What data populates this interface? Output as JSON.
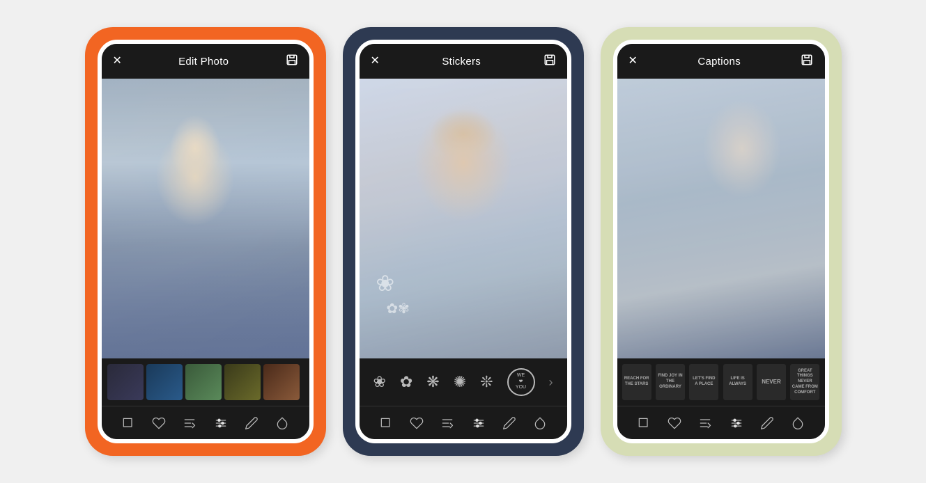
{
  "phones": [
    {
      "id": "edit-photo",
      "wrapperClass": "orange",
      "header": {
        "title": "Edit Photo",
        "closeIcon": "✕",
        "saveIcon": "💾"
      },
      "photoClass": "photo-winter",
      "stripType": "thumbnails",
      "thumbnails": [
        "thumb-1",
        "thumb-2",
        "thumb-3",
        "thumb-4",
        "thumb-5"
      ]
    },
    {
      "id": "stickers",
      "wrapperClass": "navy",
      "header": {
        "title": "Stickers",
        "closeIcon": "✕",
        "saveIcon": "💾"
      },
      "photoClass": "photo-sunglasses",
      "stripType": "stickers",
      "stickers": [
        "❀",
        "✿",
        "❋",
        "✺",
        "✻",
        "✾",
        "WE\n❤\nYOU"
      ]
    },
    {
      "id": "captions",
      "wrapperClass": "sage",
      "header": {
        "title": "Captions",
        "closeIcon": "✕",
        "saveIcon": "💾"
      },
      "photoClass": "photo-double",
      "stripType": "captions",
      "captions": [
        "reach for the stars",
        "find joy in the ordinary",
        "let's find a place",
        "life is always",
        "NEVER give up",
        "Great things never came from comfort zones"
      ]
    }
  ],
  "toolbar": {
    "icons": [
      "crop",
      "heart",
      "text",
      "sliders",
      "pen",
      "drop"
    ]
  }
}
